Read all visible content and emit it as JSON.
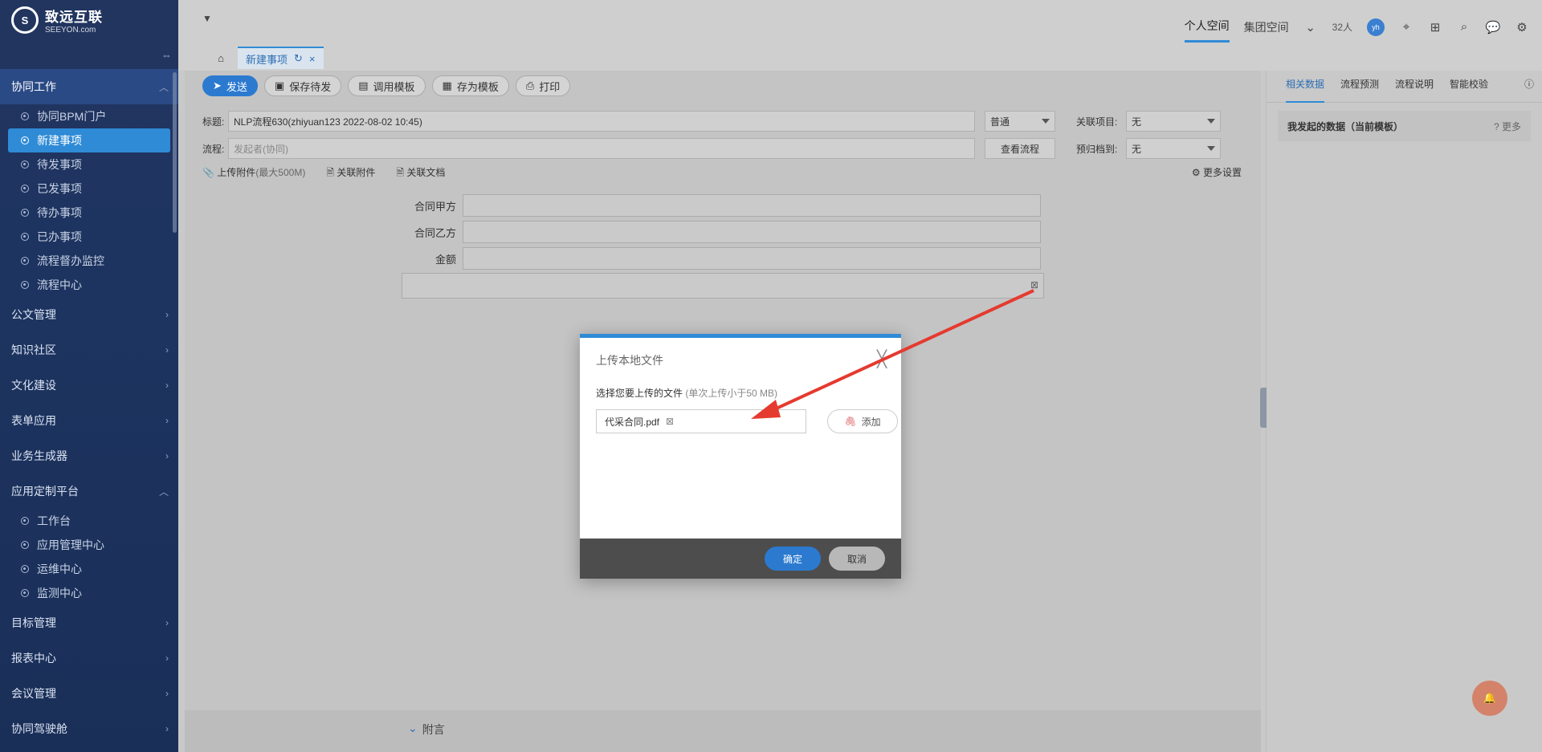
{
  "brand": {
    "name": "致远互联",
    "domain": "SEEYON.com"
  },
  "sidebar": {
    "groups": [
      {
        "label": "协同工作",
        "expanded": true,
        "items": [
          "协同BPM门户",
          "新建事项",
          "待发事项",
          "已发事项",
          "待办事项",
          "已办事项",
          "流程督办监控",
          "流程中心"
        ],
        "selected": "新建事项"
      },
      {
        "label": "公文管理"
      },
      {
        "label": "知识社区"
      },
      {
        "label": "文化建设"
      },
      {
        "label": "表单应用"
      },
      {
        "label": "业务生成器"
      },
      {
        "label": "应用定制平台",
        "expanded": true,
        "items": [
          "工作台",
          "应用管理中心",
          "运维中心",
          "监测中心"
        ]
      },
      {
        "label": "目标管理"
      },
      {
        "label": "报表中心"
      },
      {
        "label": "会议管理"
      },
      {
        "label": "协同驾驶舱"
      }
    ]
  },
  "topnav": {
    "personal": "个人空间",
    "group": "集团空间",
    "count": "32人",
    "avatar": "yh"
  },
  "tabs": {
    "active": "新建事项"
  },
  "toolbar": {
    "send": "发送",
    "save_draft": "保存待发",
    "call_template": "调用模板",
    "save_template": "存为模板",
    "print": "打印"
  },
  "form": {
    "title_label": "标题:",
    "title_value": "NLP流程630(zhiyuan123 2022-08-02 10:45)",
    "priority": "普通",
    "related_project_label": "关联项目:",
    "related_project_value": "无",
    "flow_label": "流程:",
    "flow_placeholder": "发起者(协同)",
    "view_flow": "查看流程",
    "archive_label": "预归档到:",
    "archive_value": "无",
    "upload_attachment": "上传附件",
    "upload_limit": "(最大500M)",
    "related_attachment": "关联附件",
    "related_doc": "关联文档",
    "more_settings": "更多设置",
    "fields": [
      "合同甲方",
      "合同乙方",
      "金额"
    ],
    "fuyan": "附言"
  },
  "right_panel": {
    "tabs": [
      "相关数据",
      "流程预测",
      "流程说明",
      "智能校验"
    ],
    "card_title": "我发起的数据（当前模板）",
    "more": "更多"
  },
  "modal": {
    "title": "上传本地文件",
    "hint": "选择您要上传的文件",
    "hint_note": "(单次上传小于50 MB)",
    "file_name": "代采合同.pdf",
    "add": "添加",
    "ok": "确定",
    "cancel": "取消"
  },
  "colors": {
    "accent": "#2f8bd6",
    "primary_btn": "#2b7ad0",
    "arrow": "#e53a2f"
  }
}
